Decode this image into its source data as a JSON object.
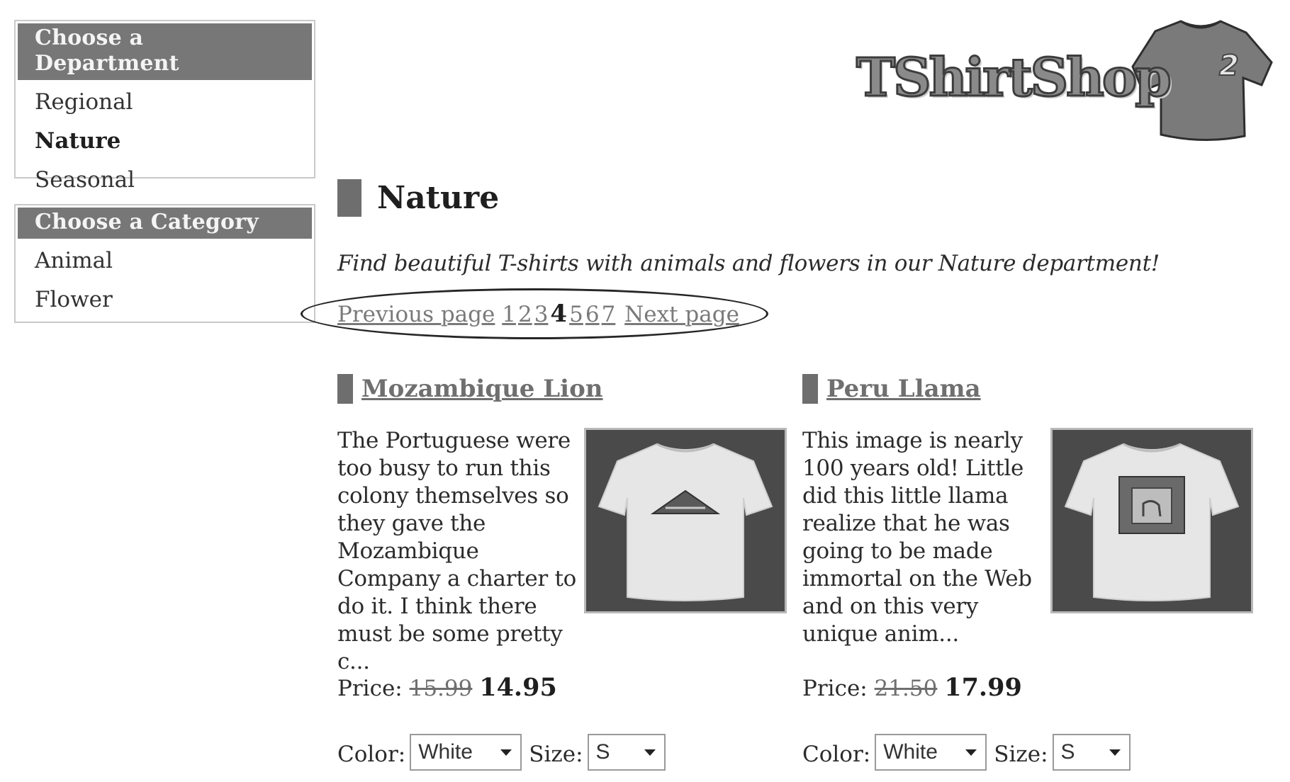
{
  "sidebar": {
    "department_box": {
      "title": "Choose a Department",
      "items": [
        {
          "label": "Regional",
          "selected": false
        },
        {
          "label": "Nature",
          "selected": true
        },
        {
          "label": "Seasonal",
          "selected": false
        }
      ]
    },
    "category_box": {
      "title": "Choose a Category",
      "items": [
        {
          "label": "Animal"
        },
        {
          "label": "Flower"
        }
      ]
    }
  },
  "logo": {
    "text": "TShirtShop",
    "superscript": "2"
  },
  "department": {
    "title": "Nature",
    "description": "Find beautiful T-shirts with animals and flowers in our Nature department!"
  },
  "pager": {
    "previous_label": "Previous page",
    "pages": [
      "1",
      "2",
      "3",
      "4",
      "5",
      "6",
      "7"
    ],
    "current_page": "4",
    "next_label": "Next page"
  },
  "products": [
    {
      "name": "Mozambique Lion",
      "description": "The Portuguese were too busy to run this colony themselves so they gave the Mozambique Company a charter to do it. I think there must be some pretty c...",
      "price_label": "Price:",
      "old_price": "15.99",
      "new_price": "14.95",
      "color_label": "Color:",
      "color_value": "White",
      "size_label": "Size:",
      "size_value": "S"
    },
    {
      "name": "Peru Llama",
      "description": "This image is nearly 100 years old! Little did this little llama realize that he was going to be made immortal on the Web and on this very unique anim...",
      "price_label": "Price:",
      "old_price": "21.50",
      "new_price": "17.99",
      "color_label": "Color:",
      "color_value": "White",
      "size_label": "Size:",
      "size_value": "S"
    }
  ],
  "colors": {
    "header_bar": "#777777",
    "accent_bar": "#6e6e6e",
    "link": "#7a7a7a",
    "pager_highlight": "#262626"
  }
}
